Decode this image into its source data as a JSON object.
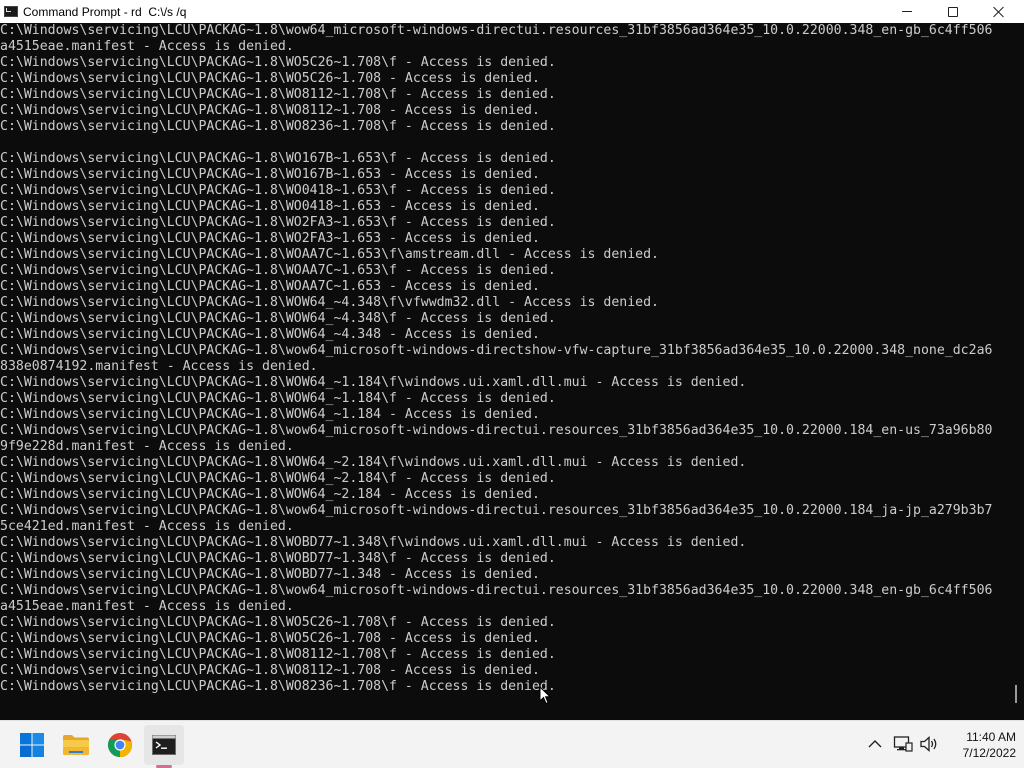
{
  "window": {
    "title": "Command Prompt - rd  C:\\/s /q"
  },
  "console": {
    "lines": [
      "C:\\Windows\\servicing\\LCU\\PACKAG~1.8\\wow64_microsoft-windows-directui.resources_31bf3856ad364e35_10.0.22000.348_en-gb_6c4ff506",
      "a4515eae.manifest - Access is denied.",
      "C:\\Windows\\servicing\\LCU\\PACKAG~1.8\\WO5C26~1.708\\f - Access is denied.",
      "C:\\Windows\\servicing\\LCU\\PACKAG~1.8\\WO5C26~1.708 - Access is denied.",
      "C:\\Windows\\servicing\\LCU\\PACKAG~1.8\\WO8112~1.708\\f - Access is denied.",
      "C:\\Windows\\servicing\\LCU\\PACKAG~1.8\\WO8112~1.708 - Access is denied.",
      "C:\\Windows\\servicing\\LCU\\PACKAG~1.8\\WO8236~1.708\\f - Access is denied.",
      "",
      "C:\\Windows\\servicing\\LCU\\PACKAG~1.8\\WO167B~1.653\\f - Access is denied.",
      "C:\\Windows\\servicing\\LCU\\PACKAG~1.8\\WO167B~1.653 - Access is denied.",
      "C:\\Windows\\servicing\\LCU\\PACKAG~1.8\\WO0418~1.653\\f - Access is denied.",
      "C:\\Windows\\servicing\\LCU\\PACKAG~1.8\\WO0418~1.653 - Access is denied.",
      "C:\\Windows\\servicing\\LCU\\PACKAG~1.8\\WO2FA3~1.653\\f - Access is denied.",
      "C:\\Windows\\servicing\\LCU\\PACKAG~1.8\\WO2FA3~1.653 - Access is denied.",
      "C:\\Windows\\servicing\\LCU\\PACKAG~1.8\\WOAA7C~1.653\\f\\amstream.dll - Access is denied.",
      "C:\\Windows\\servicing\\LCU\\PACKAG~1.8\\WOAA7C~1.653\\f - Access is denied.",
      "C:\\Windows\\servicing\\LCU\\PACKAG~1.8\\WOAA7C~1.653 - Access is denied.",
      "C:\\Windows\\servicing\\LCU\\PACKAG~1.8\\WOW64_~4.348\\f\\vfwwdm32.dll - Access is denied.",
      "C:\\Windows\\servicing\\LCU\\PACKAG~1.8\\WOW64_~4.348\\f - Access is denied.",
      "C:\\Windows\\servicing\\LCU\\PACKAG~1.8\\WOW64_~4.348 - Access is denied.",
      "C:\\Windows\\servicing\\LCU\\PACKAG~1.8\\wow64_microsoft-windows-directshow-vfw-capture_31bf3856ad364e35_10.0.22000.348_none_dc2a6",
      "838e0874192.manifest - Access is denied.",
      "C:\\Windows\\servicing\\LCU\\PACKAG~1.8\\WOW64_~1.184\\f\\windows.ui.xaml.dll.mui - Access is denied.",
      "C:\\Windows\\servicing\\LCU\\PACKAG~1.8\\WOW64_~1.184\\f - Access is denied.",
      "C:\\Windows\\servicing\\LCU\\PACKAG~1.8\\WOW64_~1.184 - Access is denied.",
      "C:\\Windows\\servicing\\LCU\\PACKAG~1.8\\wow64_microsoft-windows-directui.resources_31bf3856ad364e35_10.0.22000.184_en-us_73a96b80",
      "9f9e228d.manifest - Access is denied.",
      "C:\\Windows\\servicing\\LCU\\PACKAG~1.8\\WOW64_~2.184\\f\\windows.ui.xaml.dll.mui - Access is denied.",
      "C:\\Windows\\servicing\\LCU\\PACKAG~1.8\\WOW64_~2.184\\f - Access is denied.",
      "C:\\Windows\\servicing\\LCU\\PACKAG~1.8\\WOW64_~2.184 - Access is denied.",
      "C:\\Windows\\servicing\\LCU\\PACKAG~1.8\\wow64_microsoft-windows-directui.resources_31bf3856ad364e35_10.0.22000.184_ja-jp_a279b3b7",
      "5ce421ed.manifest - Access is denied.",
      "C:\\Windows\\servicing\\LCU\\PACKAG~1.8\\WOBD77~1.348\\f\\windows.ui.xaml.dll.mui - Access is denied.",
      "C:\\Windows\\servicing\\LCU\\PACKAG~1.8\\WOBD77~1.348\\f - Access is denied.",
      "C:\\Windows\\servicing\\LCU\\PACKAG~1.8\\WOBD77~1.348 - Access is denied.",
      "C:\\Windows\\servicing\\LCU\\PACKAG~1.8\\wow64_microsoft-windows-directui.resources_31bf3856ad364e35_10.0.22000.348_en-gb_6c4ff506",
      "a4515eae.manifest - Access is denied.",
      "C:\\Windows\\servicing\\LCU\\PACKAG~1.8\\WO5C26~1.708\\f - Access is denied.",
      "C:\\Windows\\servicing\\LCU\\PACKAG~1.8\\WO5C26~1.708 - Access is denied.",
      "C:\\Windows\\servicing\\LCU\\PACKAG~1.8\\WO8112~1.708\\f - Access is denied.",
      "C:\\Windows\\servicing\\LCU\\PACKAG~1.8\\WO8112~1.708 - Access is denied.",
      "C:\\Windows\\servicing\\LCU\\PACKAG~1.8\\WO8236~1.708\\f - Access is denied."
    ]
  },
  "taskbar": {
    "apps": [
      {
        "id": "start",
        "icon": "windows-start-icon"
      },
      {
        "id": "explorer",
        "icon": "file-explorer-icon"
      },
      {
        "id": "chrome",
        "icon": "chrome-icon"
      },
      {
        "id": "cmd",
        "icon": "command-prompt-icon",
        "active": true
      }
    ],
    "tray": {
      "chevron_icon": "chevron-up-icon",
      "network_icon": "network-icon",
      "volume_icon": "volume-icon"
    },
    "clock": {
      "time": "11:40 AM",
      "date": "7/12/2022"
    }
  },
  "colors": {
    "console_bg": "#0c0c0c",
    "console_fg": "#cccccc",
    "taskbar_bg": "#f3f3f3",
    "accent": "#0078d4",
    "active_indicator": "#d0708a"
  }
}
